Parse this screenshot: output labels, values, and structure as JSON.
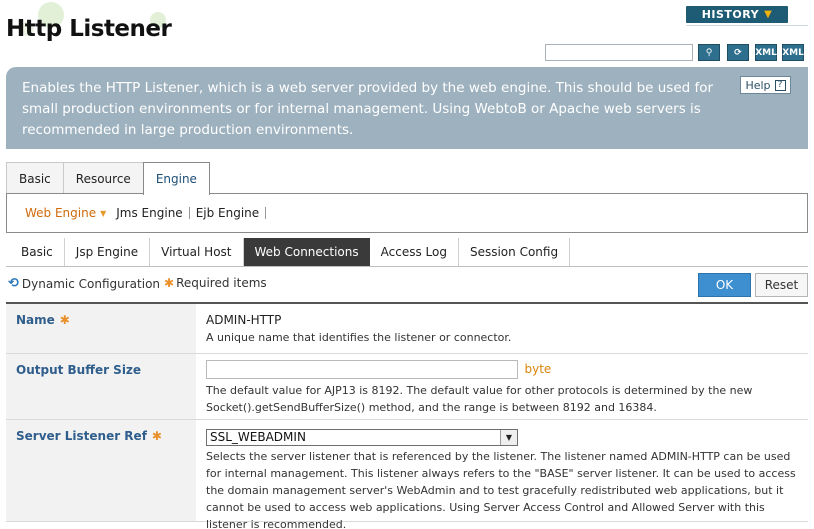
{
  "page": {
    "title": "Http Listener",
    "history_label": "HISTORY",
    "description": "Enables the HTTP Listener, which is a web server provided by the web engine. This should be used for small production environments or for internal management. Using WebtoB or Apache web servers is recommended in large production environments.",
    "help_label": "Help"
  },
  "toolbar": {
    "search_value": "",
    "icons": [
      "search-icon",
      "refresh-icon",
      "xml-import-icon",
      "xml-export-icon"
    ],
    "icon_glyphs": [
      "⚲",
      "⟳",
      "XML",
      "XML"
    ]
  },
  "tabs": [
    "Basic",
    "Resource",
    "Engine"
  ],
  "engine_subnav": [
    "Web Engine",
    "Jms Engine",
    "Ejb Engine"
  ],
  "web_tabs": [
    "Basic",
    "Jsp Engine",
    "Virtual Host",
    "Web Connections",
    "Access Log",
    "Session Config"
  ],
  "legend": {
    "dynamic": "Dynamic Configuration",
    "required": "Required items"
  },
  "actions": {
    "ok": "OK",
    "reset": "Reset"
  },
  "form": {
    "name": {
      "label": "Name",
      "value": "ADMIN-HTTP",
      "help": "A unique name that identifies the listener or connector."
    },
    "output_buffer": {
      "label": "Output Buffer Size",
      "value": "",
      "unit": "byte",
      "help": "The default value for AJP13 is 8192. The default value for other protocols is determined by the new Socket().getSendBufferSize() method, and the range is between 8192 and 16384."
    },
    "server_listener_ref": {
      "label": "Server Listener Ref",
      "value": "SSL_WEBADMIN",
      "help": "Selects the server listener that is referenced by the listener. The listener named ADMIN-HTTP can be used for internal management. This listener always refers to the \"BASE\" server listener. It can be used to access the domain management server's WebAdmin and to test gracefully redistributed web applications, but it cannot be used to access web applications. Using Server Access Control and Allowed Server with this listener is recommended."
    }
  },
  "colors": {
    "accent": "#1e5c75",
    "description_bg": "#9eb1bf",
    "label_blue": "#2f5e8c",
    "required_star": "#e9902a",
    "ok_button": "#3d8fd0",
    "active_subnav": "#d06a0a"
  }
}
